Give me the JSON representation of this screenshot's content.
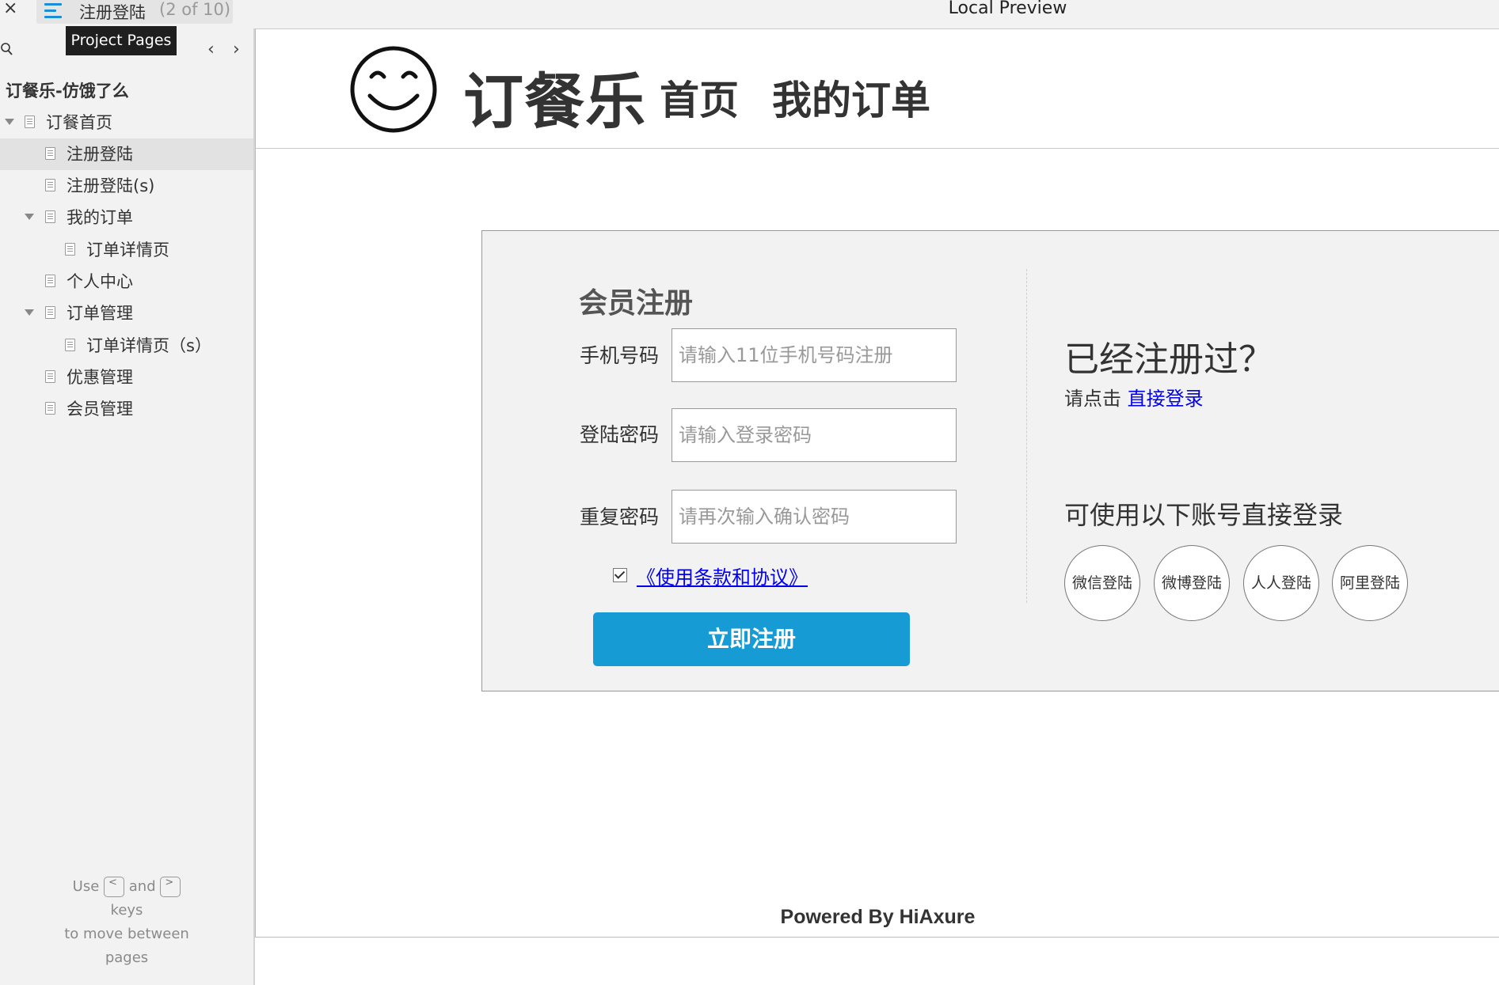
{
  "topbar": {
    "close_symbol": "×",
    "current_page": "注册登陆",
    "page_count": "(2 of 10)",
    "preview_title": "Local Preview",
    "tooltip": "Project Pages",
    "prev_symbol": "‹",
    "next_symbol": "›",
    "icons": [
      "close-icon",
      "menu-icon",
      "search-icon",
      "chevron-left-icon",
      "chevron-right-icon"
    ]
  },
  "sidebar": {
    "project_name": "订餐乐-仿饿了么",
    "items": [
      {
        "label": "订餐首页",
        "expanded": true,
        "active": false
      },
      {
        "label": "注册登陆",
        "active": true
      },
      {
        "label": "注册登陆(s)",
        "active": false
      },
      {
        "label": "我的订单",
        "expanded": true,
        "active": false
      },
      {
        "label": "订单详情页",
        "active": false
      },
      {
        "label": "个人中心",
        "active": false
      },
      {
        "label": "订单管理",
        "expanded": true,
        "active": false
      },
      {
        "label": "订单详情页（s）",
        "active": false
      },
      {
        "label": "优惠管理",
        "active": false
      },
      {
        "label": "会员管理",
        "active": false
      }
    ],
    "hint": {
      "use": "Use",
      "and": "and",
      "keys": "keys",
      "line2": "to move between",
      "line3": "pages",
      "key_left": "<",
      "key_right": ">"
    }
  },
  "site": {
    "name": "订餐乐",
    "nav_home": "首页",
    "nav_orders": "我的订单",
    "logo_icon": "smiley-face-icon"
  },
  "register": {
    "title": "会员注册",
    "phone_label": "手机号码",
    "phone_placeholder": "请输入11位手机号码注册",
    "password_label": "登陆密码",
    "password_placeholder": "请输入登录密码",
    "repeat_label": "重复密码",
    "repeat_placeholder": "请再次输入确认密码",
    "terms_checked": true,
    "terms_link": "《使用条款和协议》",
    "submit": "立即注册"
  },
  "login_side": {
    "title": "已经注册过？",
    "prompt": "请点击 ",
    "link": "直接登录",
    "third_party_title": "可使用以下账号直接登录",
    "third_party": [
      "微信登陆",
      "微博登陆",
      "人人登陆",
      "阿里登陆"
    ]
  },
  "footer": {
    "powered": "Powered By HiAxure"
  },
  "colors": {
    "accent": "#169bd5",
    "link": "#0000ee",
    "panel_bg": "#f2f2f2",
    "sidebar_bg": "#f2f2f2"
  }
}
